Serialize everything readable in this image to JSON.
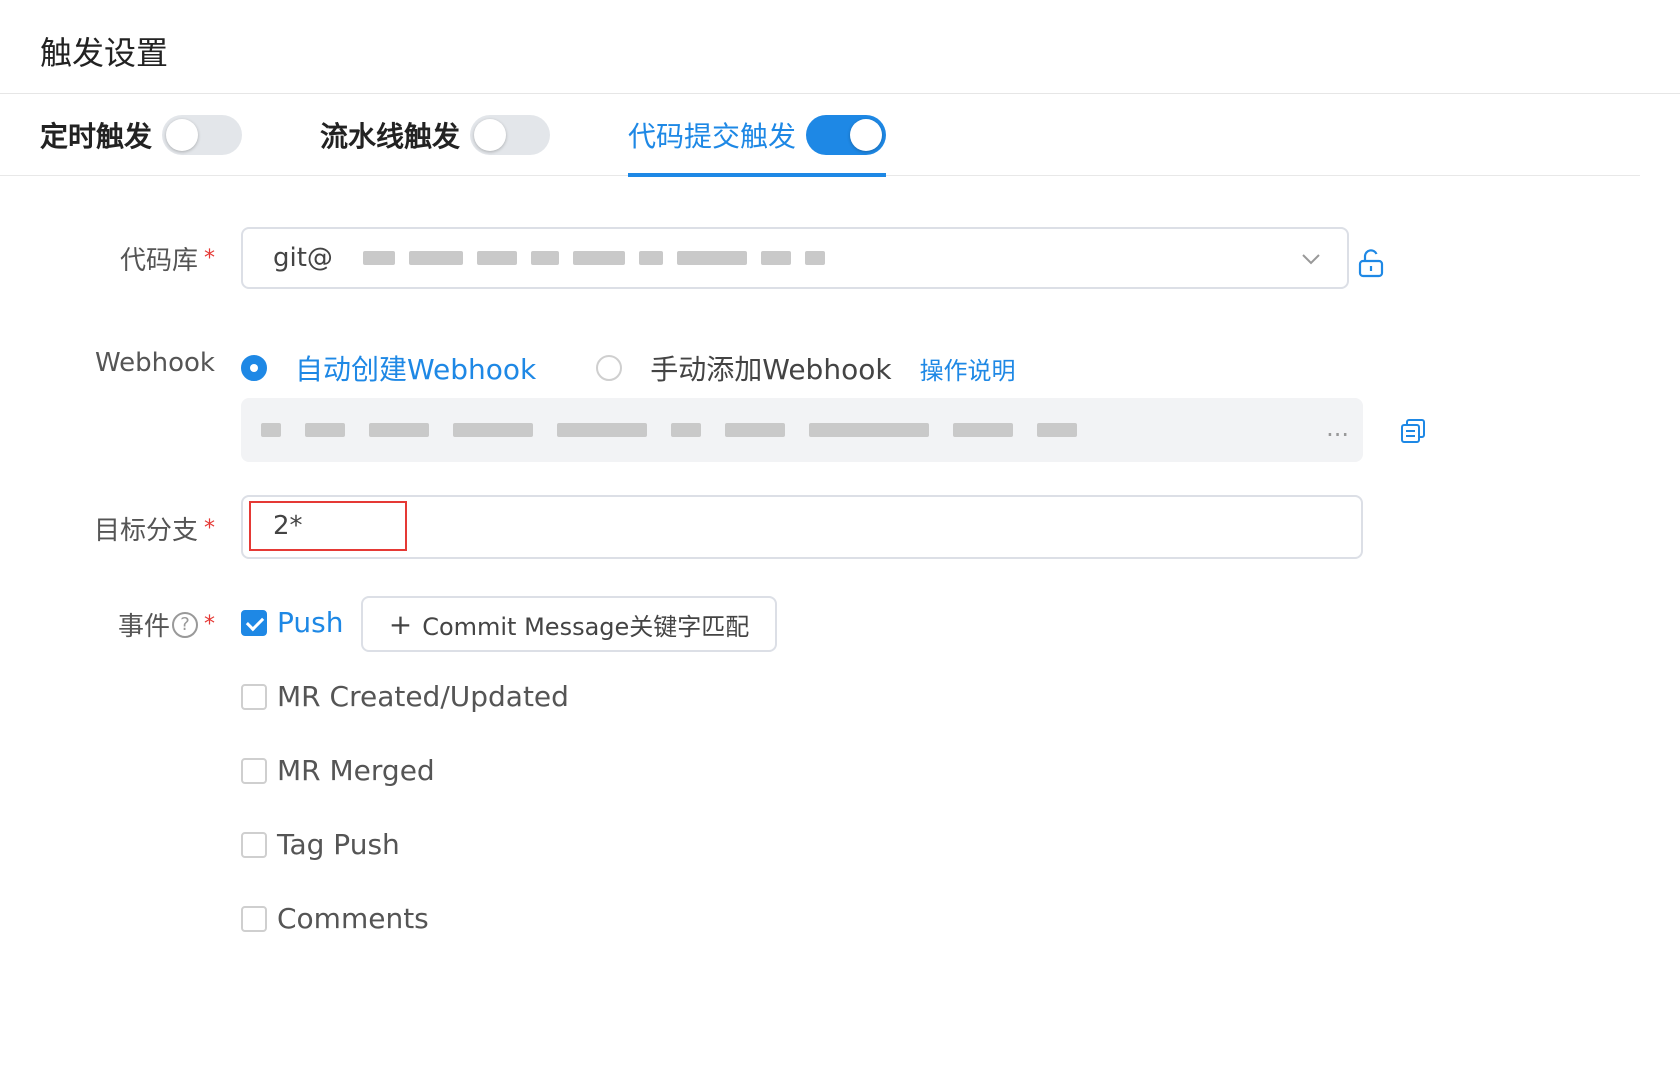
{
  "header": {
    "title": "触发设置"
  },
  "tabs": [
    {
      "label": "定时触发",
      "enabled": false,
      "active": false
    },
    {
      "label": "流水线触发",
      "enabled": false,
      "active": false
    },
    {
      "label": "代码提交触发",
      "enabled": true,
      "active": true
    }
  ],
  "repo": {
    "label": "代码库",
    "value_prefix": "git@",
    "lock_icon": "unlock-icon"
  },
  "webhook": {
    "label": "Webhook",
    "options": [
      {
        "label": "自动创建Webhook",
        "selected": true
      },
      {
        "label": "手动添加Webhook",
        "selected": false
      }
    ],
    "help_link": "操作说明",
    "url_ellipsis": "...",
    "copy_icon": "copy-icon"
  },
  "branch": {
    "label": "目标分支",
    "value": "2*"
  },
  "events": {
    "label": "事件",
    "commit_button": "Commit Message关键字匹配",
    "items": [
      {
        "label": "Push",
        "checked": true
      },
      {
        "label": "MR Created/Updated",
        "checked": false
      },
      {
        "label": "MR Merged",
        "checked": false
      },
      {
        "label": "Tag Push",
        "checked": false
      },
      {
        "label": "Comments",
        "checked": false
      }
    ]
  },
  "colors": {
    "accent": "#1e88e5",
    "required": "#e53935",
    "border": "#dcdfe6"
  }
}
